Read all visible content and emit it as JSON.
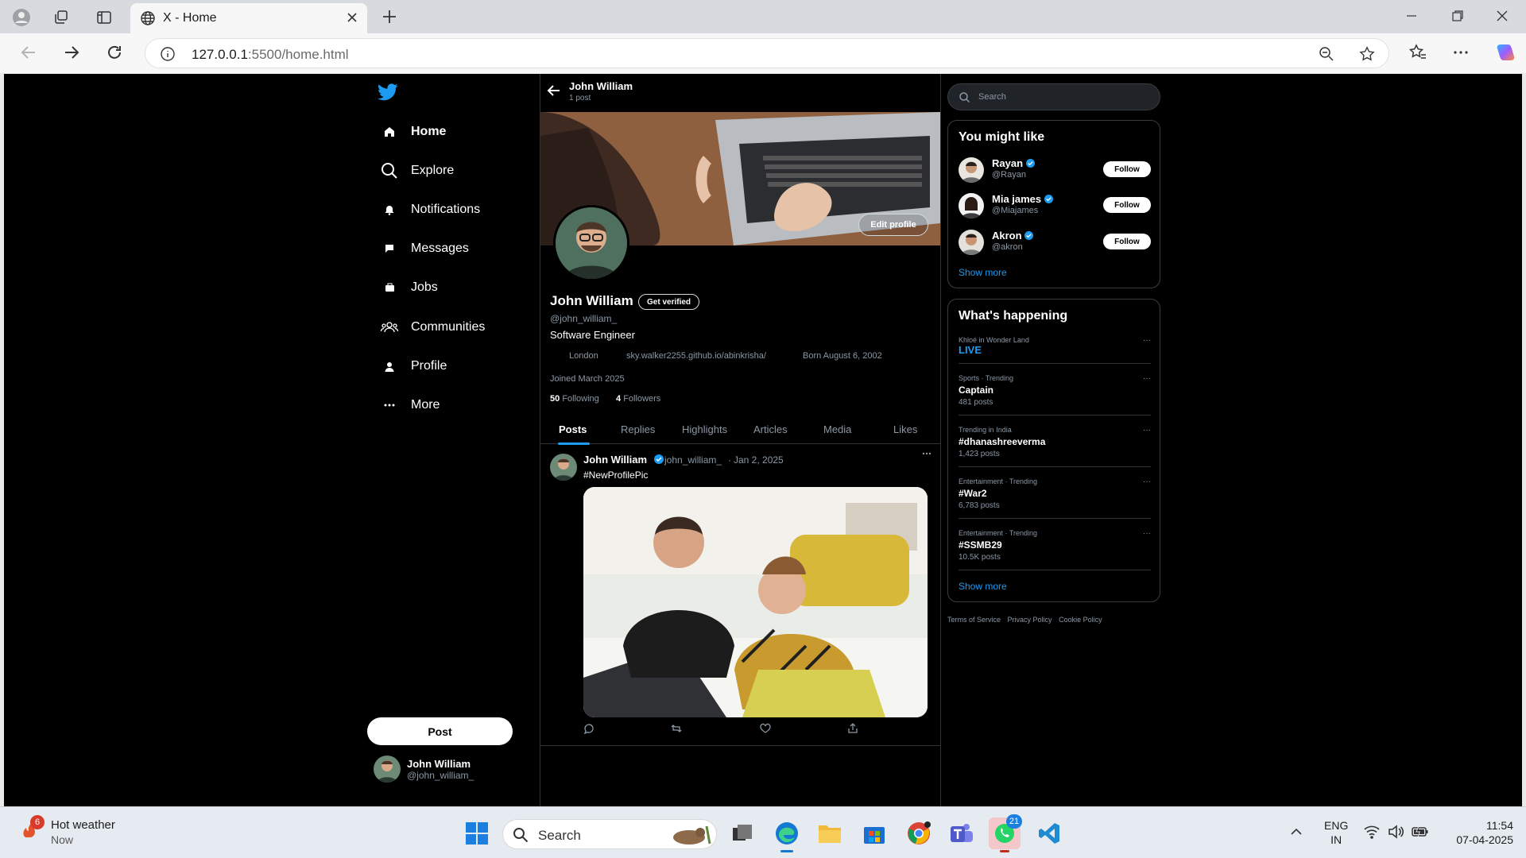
{
  "browser": {
    "tab_title": "X - Home",
    "url_host": "127.0.0.1",
    "url_rest": ":5500/home.html"
  },
  "nav": {
    "items": [
      {
        "label": "Home",
        "icon": "home-icon"
      },
      {
        "label": "Explore",
        "icon": "search-icon"
      },
      {
        "label": "Notifications",
        "icon": "bell-icon"
      },
      {
        "label": "Messages",
        "icon": "message-icon"
      },
      {
        "label": "Jobs",
        "icon": "briefcase-icon"
      },
      {
        "label": "Communities",
        "icon": "people-icon"
      },
      {
        "label": "Profile",
        "icon": "user-icon"
      },
      {
        "label": "More",
        "icon": "more-icon"
      }
    ],
    "post_label": "Post",
    "account_name": "John William",
    "account_handle": "@john_william_"
  },
  "profile": {
    "header_name": "John William",
    "header_count": "1 post",
    "edit_label": "Edit profile",
    "name": "John William",
    "get_verified": "Get verified",
    "handle": "@john_william_",
    "bio": "Software Engineer",
    "location": "London",
    "website": "sky.walker2255.github.io/abinkrisha/",
    "born": "Born August 6, 2002",
    "joined": "Joined March 2025",
    "following_count": "50",
    "following_label": "Following",
    "followers_count": "4",
    "followers_label": "Followers",
    "tabs": [
      "Posts",
      "Replies",
      "Highlights",
      "Articles",
      "Media",
      "Likes"
    ]
  },
  "tweet": {
    "name": "John William",
    "handle": "john_william_",
    "sep": "·",
    "date": "Jan 2, 2025",
    "text": "#NewProfilePic"
  },
  "right": {
    "search_placeholder": "Search",
    "wtf_title": "You might like",
    "suggestions": [
      {
        "name": "Rayan",
        "handle": "@Rayan",
        "button": "Follow"
      },
      {
        "name": "Mia james",
        "handle": "@Miajames",
        "button": "Follow"
      },
      {
        "name": "Akron",
        "handle": "@akron",
        "button": "Follow"
      }
    ],
    "show_more": "Show more",
    "trends_title": "What's happening",
    "trends": [
      {
        "context": "Khloé in Wonder Land",
        "title": "LIVE",
        "count": ""
      },
      {
        "context": "Sports · Trending",
        "title": "Captain",
        "count": "481 posts"
      },
      {
        "context": "Trending in India",
        "title": "#dhanashreeverma",
        "count": "1,423 posts"
      },
      {
        "context": "Entertainment · Trending",
        "title": "#War2",
        "count": "6,783 posts"
      },
      {
        "context": "Entertainment · Trending",
        "title": "#SSMB29",
        "count": "10.5K posts"
      }
    ],
    "trends_show_more": "Show more",
    "footer": [
      "Terms of Service",
      "Privacy Policy",
      "Cookie Policy"
    ]
  },
  "taskbar": {
    "weather_badge": "6",
    "weather_title": "Hot weather",
    "weather_sub": "Now",
    "search_label": "Search",
    "whatsapp_badge": "21",
    "lang1": "ENG",
    "lang2": "IN",
    "time": "11:54",
    "date": "07-04-2025"
  },
  "colors": {
    "accent": "#1d9bf0",
    "background": "#000000"
  }
}
